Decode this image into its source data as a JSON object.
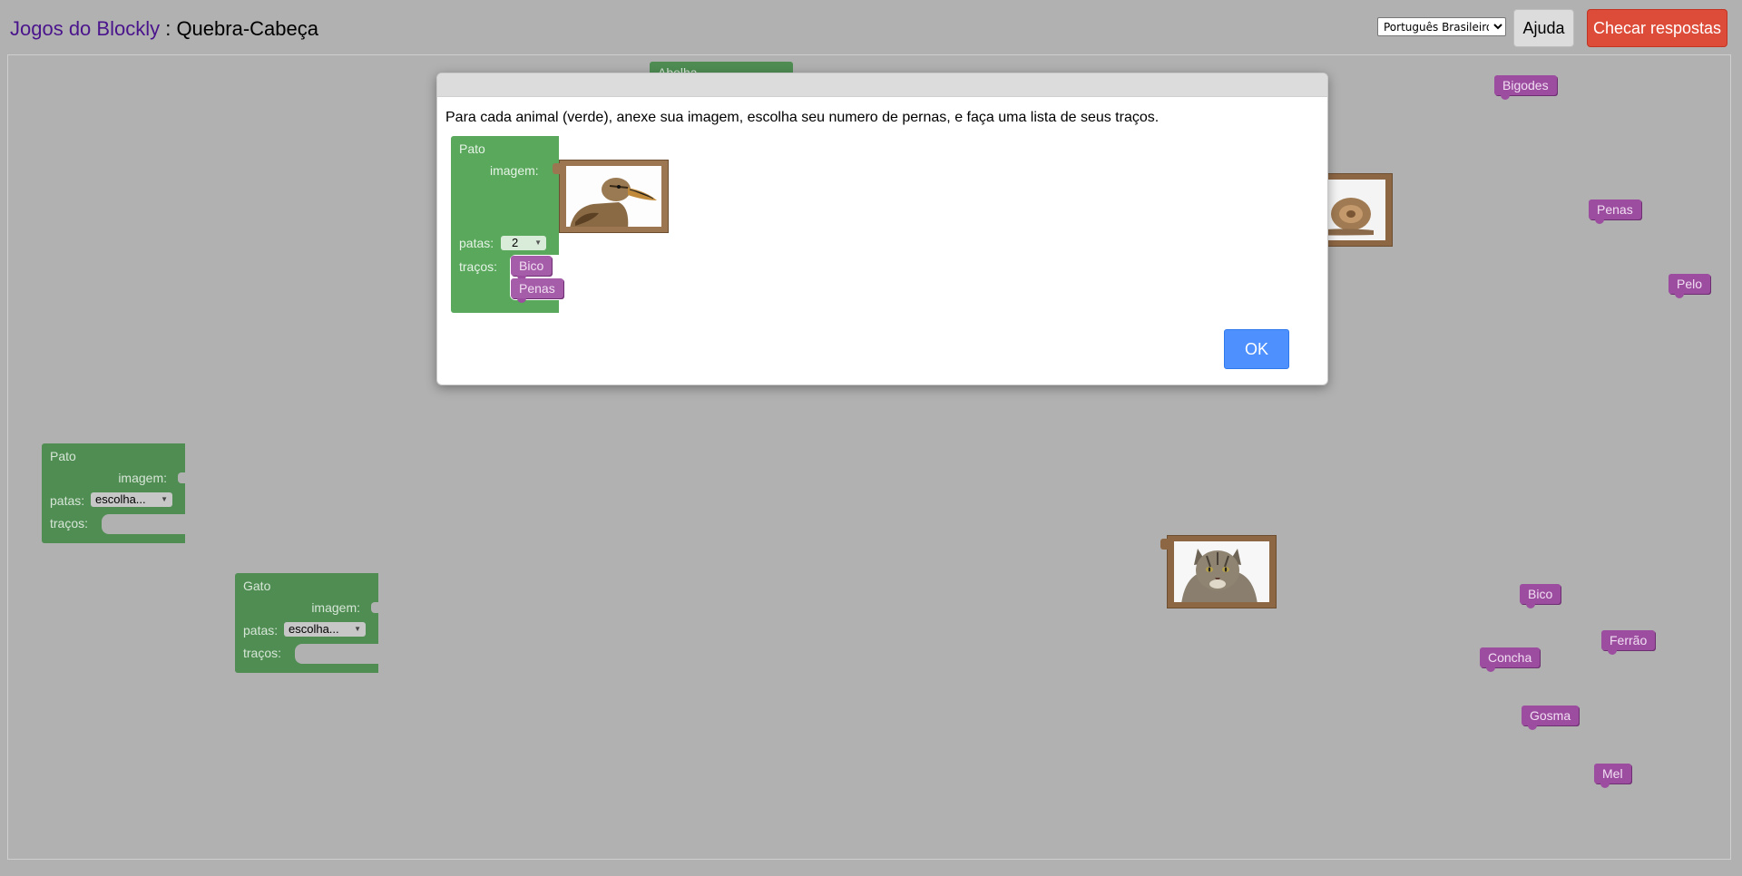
{
  "header": {
    "app_name": "Jogos do Blockly",
    "separator": " : ",
    "page_title": "Quebra-Cabeça",
    "language_selected": "Português Brasileiro",
    "help_label": "Ajuda",
    "check_label": "Checar respostas"
  },
  "workspace": {
    "partial_block_label": "Abelha",
    "animal_blocks": [
      {
        "name": "Pato",
        "image_label": "imagem:",
        "legs_label": "patas:",
        "legs_value": "escolha...",
        "traits_label": "traços:"
      },
      {
        "name": "Gato",
        "image_label": "imagem:",
        "legs_label": "patas:",
        "legs_value": "escolha...",
        "traits_label": "traços:"
      }
    ],
    "traits": [
      "Bigodes",
      "Penas",
      "Pelo",
      "Bico",
      "Ferrão",
      "Concha",
      "Gosma",
      "Mel"
    ],
    "pictures": [
      "snail-image",
      "cat-image"
    ]
  },
  "dialog": {
    "instruction": "Para cada animal (verde), anexe sua imagem, escolha seu numero de pernas, e faça uma lista de seus traços.",
    "example": {
      "name": "Pato",
      "image_label": "imagem:",
      "legs_label": "patas:",
      "legs_value": "2",
      "traits_label": "traços:",
      "traits": [
        "Bico",
        "Penas"
      ],
      "picture": "duck-image"
    },
    "ok_label": "OK"
  },
  "colors": {
    "animal_block": "#4f8d53",
    "trait_block": "#9c4da0",
    "picture_frame": "#8d6744",
    "check_button": "#dd4b39",
    "ok_button": "#4d90fe"
  }
}
